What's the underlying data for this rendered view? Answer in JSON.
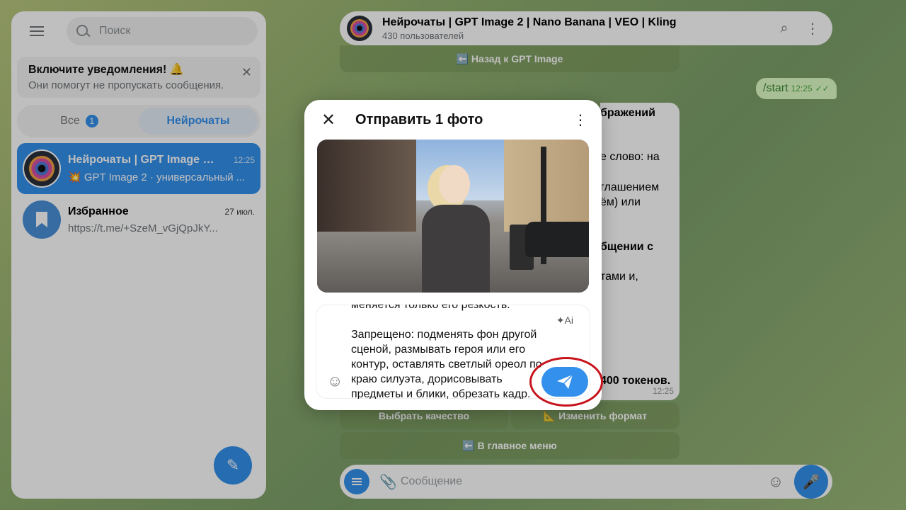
{
  "sidebar": {
    "search_placeholder": "Поиск",
    "notification": {
      "title": "Включите уведомления! 🔔",
      "subtitle": "Они помогут не пропускать сообщения."
    },
    "tabs": [
      {
        "label": "Все",
        "badge": "1"
      },
      {
        "label": "Нейрочаты"
      }
    ],
    "chats": [
      {
        "name": "Нейрочаты | GPT Image 2 | ...",
        "time": "12:25",
        "preview": "💥 GPT Image 2 · универсальный ..."
      },
      {
        "name": "Избранное",
        "time": "27 июл.",
        "preview": "https://t.me/+SzeM_vGjQpJkY..."
      }
    ]
  },
  "chat": {
    "title": "Нейрочаты | GPT Image 2 | Nano Banana | VEO | Kling",
    "subtitle": "430 пользователей",
    "back_button": "⬅️ Назад к GPT Image",
    "outgoing": {
      "text": "/start",
      "time": "12:25"
    },
    "incoming_fragments": [
      "бражений",
      "е слово: на",
      "глашением",
      "ём) или",
      "бщении с",
      "тами и,",
      "400 токенов."
    ],
    "incoming_time": "12:25",
    "buttons": {
      "quality": "Выбрать качество",
      "format": "📐 Изменить формат",
      "main_menu": "⬅️ В главное меню"
    },
    "composer_placeholder": "Сообщение"
  },
  "modal": {
    "title": "Отправить 1 фото",
    "caption": "меняется только его резкость.\n\nЗапрещено: подменять фон другой сценой, размывать героя или его контур, оставлять светлый ореол по краю силуэта, дорисовывать предметы и блики, обрезать кадр.",
    "ai_label": "Ai"
  }
}
